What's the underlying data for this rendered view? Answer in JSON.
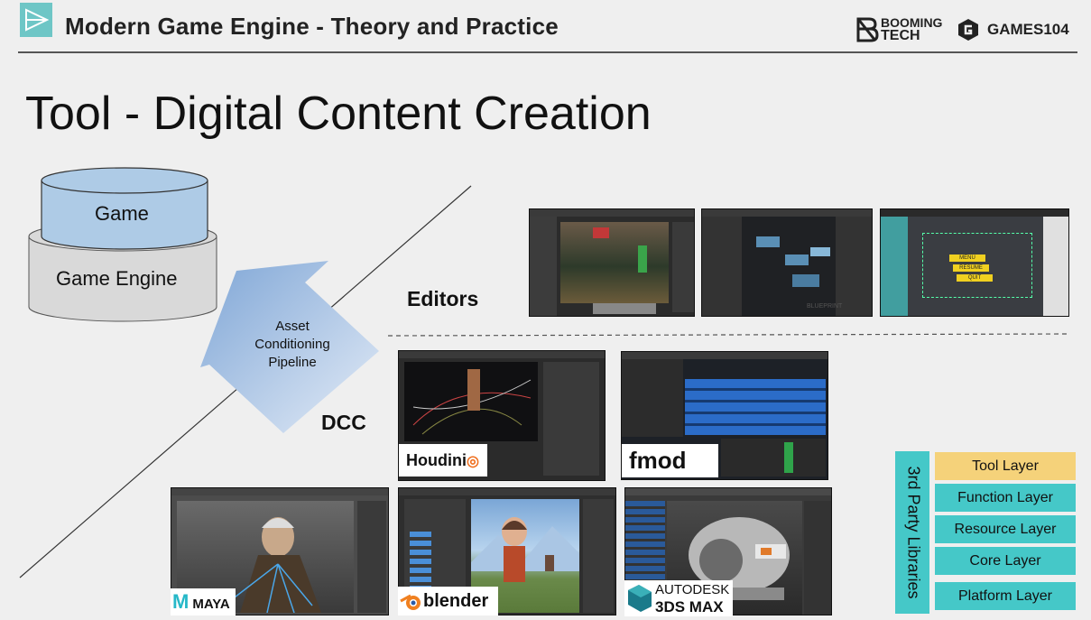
{
  "header": {
    "title": "Modern Game Engine - Theory and Practice",
    "brand_booming_line1": "BOOMING",
    "brand_booming_line2": "TECH",
    "brand_games": "GAMES104"
  },
  "slide": {
    "title": "Tool - Digital Content Creation"
  },
  "diagram": {
    "game_label": "Game",
    "engine_label": "Game Engine",
    "pipeline_line1": "Asset",
    "pipeline_line2": "Conditioning",
    "pipeline_line3": "Pipeline",
    "editors_label": "Editors",
    "dcc_label": "DCC"
  },
  "tools": {
    "houdini": "Houdini",
    "fmod": "fmod",
    "maya": "MAYA",
    "blender": "blender",
    "autodesk": "AUTODESK",
    "max": "3DS MAX",
    "ue_widget_1": "MENU",
    "ue_widget_2": "RESUME",
    "ue_widget_3": "QUIT",
    "blueprint": "BLUEPRINT"
  },
  "layers": {
    "third_party": "3rd Party Libraries",
    "items": [
      "Tool Layer",
      "Function Layer",
      "Resource Layer",
      "Core Layer",
      "Platform Layer"
    ]
  },
  "colors": {
    "accent_teal": "#45c8c8",
    "tool_layer": "#f5d27a",
    "game_cylinder": "#aecbe6",
    "engine_cylinder": "#d8d8d8"
  }
}
